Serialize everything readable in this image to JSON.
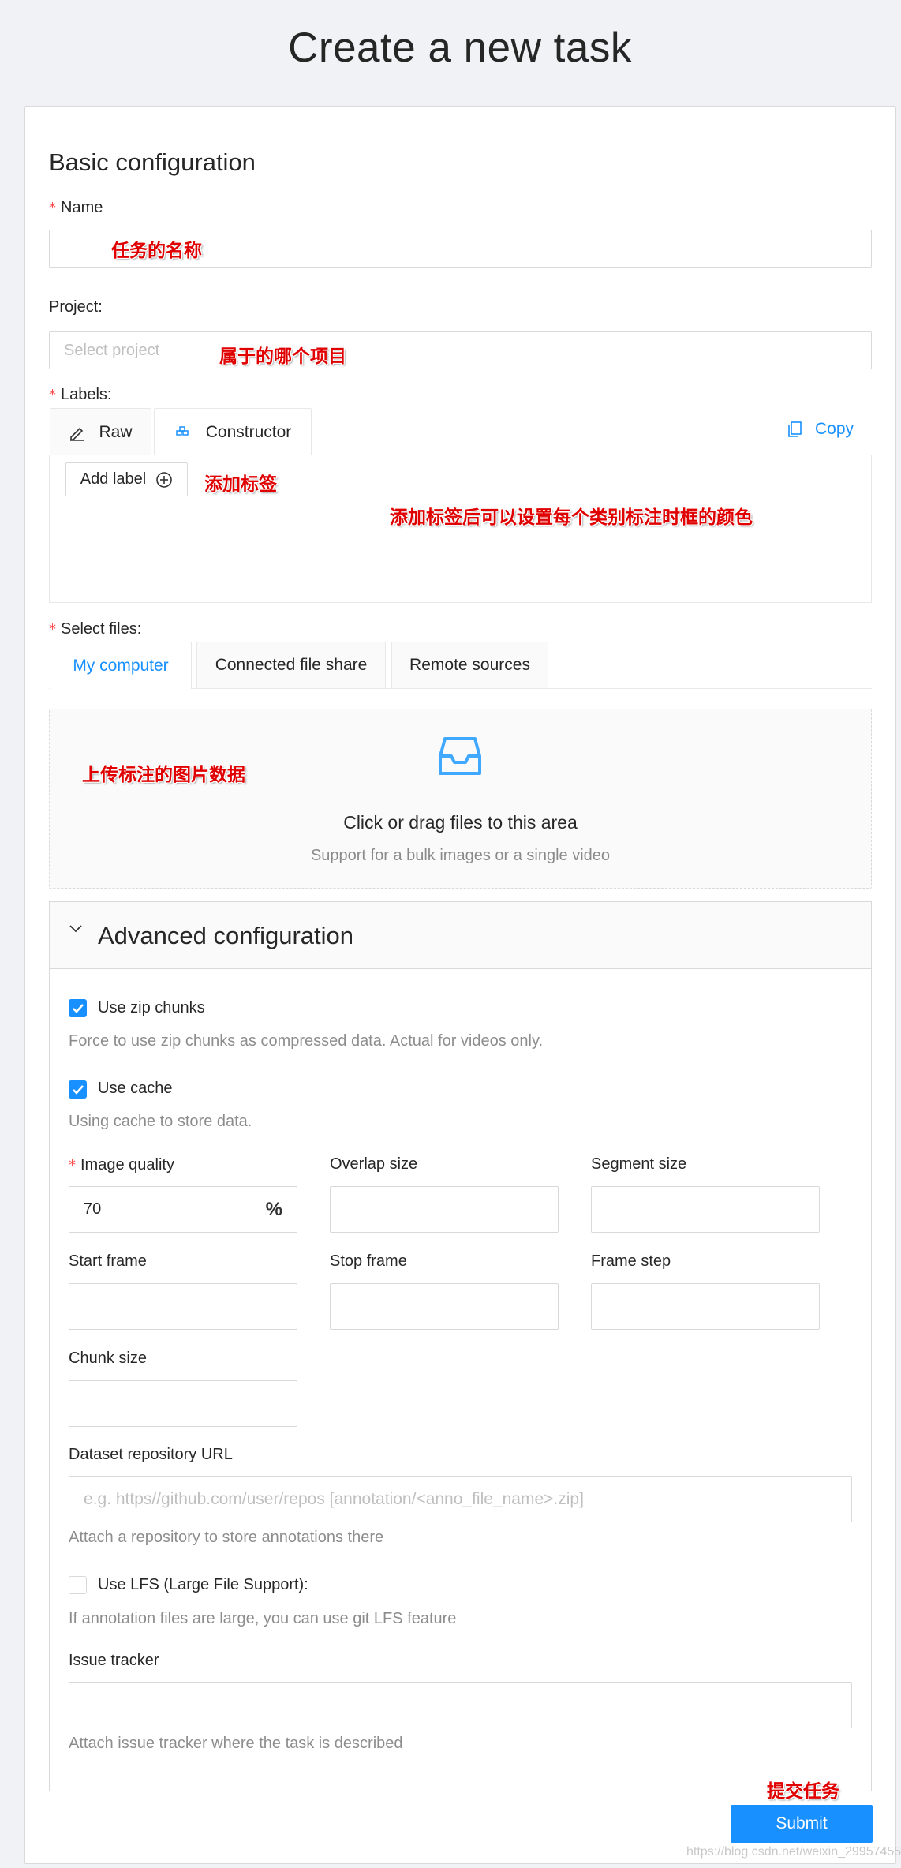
{
  "page": {
    "title": "Create a new task"
  },
  "basic": {
    "heading": "Basic configuration",
    "name_label": "Name",
    "name_value": "任务的名称",
    "project_label": "Project:",
    "project_placeholder": "Select project",
    "project_annotation": "属于的哪个项目",
    "labels_label": "Labels:",
    "tabs": [
      {
        "label": "Raw"
      },
      {
        "label": "Constructor"
      }
    ],
    "copy_label": "Copy",
    "add_label_button": "Add label",
    "add_label_annotation": "添加标签",
    "color_annotation": "添加标签后可以设置每个类别标注时框的颜色"
  },
  "files": {
    "label": "Select files:",
    "tabs": [
      {
        "label": "My computer"
      },
      {
        "label": "Connected file share"
      },
      {
        "label": "Remote sources"
      }
    ],
    "upload_annotation": "上传标注的图片数据",
    "drag_title": "Click or drag files to this area",
    "drag_hint": "Support for a bulk images or a single video"
  },
  "advanced": {
    "heading": "Advanced configuration",
    "zip_chunks_label": "Use zip chunks",
    "zip_chunks_help": "Force to use zip chunks as compressed data. Actual for videos only.",
    "zip_chunks_checked": true,
    "cache_label": "Use cache",
    "cache_help": "Using cache to store data.",
    "cache_checked": true,
    "image_quality_label": "Image quality",
    "image_quality_value": "70",
    "image_quality_suffix": "%",
    "overlap_label": "Overlap size",
    "segment_label": "Segment size",
    "start_frame_label": "Start frame",
    "stop_frame_label": "Stop frame",
    "frame_step_label": "Frame step",
    "chunk_size_label": "Chunk size",
    "repo_label": "Dataset repository URL",
    "repo_placeholder": "e.g. https//github.com/user/repos [annotation/<anno_file_name>.zip]",
    "repo_help": "Attach a repository to store annotations there",
    "lfs_label": "Use LFS (Large File Support):",
    "lfs_help": "If annotation files are large, you can use git LFS feature",
    "lfs_checked": false,
    "issue_label": "Issue tracker",
    "issue_help": "Attach issue tracker where the task is described"
  },
  "footer": {
    "submit_annotation": "提交任务",
    "submit_label": "Submit",
    "watermark": "https://blog.csdn.net/weixin_29957455"
  },
  "colors": {
    "primary": "#1890ff",
    "required": "#ff4d4f",
    "annotation": "#e00000"
  }
}
